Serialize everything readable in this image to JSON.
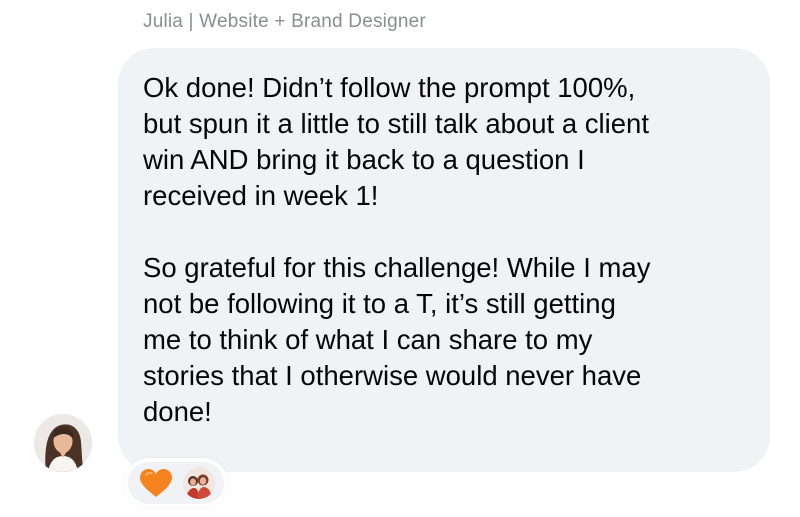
{
  "message": {
    "sender_name": "Julia | Website + Brand Designer",
    "paragraphs": [
      "Ok done! Didn’t follow the prompt 100%,\nbut spun it a little to still talk about a client\nwin AND bring it back to a question I\nreceived in week 1!",
      "So grateful for this challenge! While I may\nnot be following it to a T, it’s still getting\nme to think of what I can share to my\nstories that I otherwise would never have\ndone!"
    ]
  },
  "reaction": {
    "emoji_icon": "orange-heart-icon",
    "heart_color": "#f5841f"
  },
  "colors": {
    "bubble": "#f1f2f5",
    "name": "#8a8d91",
    "text": "#050505"
  }
}
